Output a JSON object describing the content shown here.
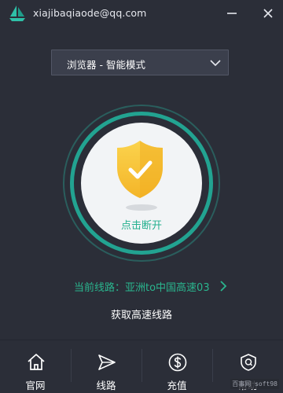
{
  "titlebar": {
    "account": "xiajibaqiaode@qq.com",
    "logo_icon": "sailboat-logo-icon",
    "minimize_icon": "minimize-icon",
    "close_icon": "close-icon"
  },
  "mode_select": {
    "value": "浏览器 - 智能模式",
    "icon": "chevron-down-icon"
  },
  "connect_button": {
    "label": "点击断开",
    "icon": "shield-check-icon",
    "status_color": "#25b08f"
  },
  "route": {
    "label": "当前线路：亚洲to中国高速03",
    "arrow_icon": "chevron-right-icon"
  },
  "fast_route": {
    "label": "获取高速线路"
  },
  "bottom_nav": {
    "items": [
      {
        "label": "官网",
        "icon": "home-icon"
      },
      {
        "label": "线路",
        "icon": "send-icon"
      },
      {
        "label": "充值",
        "icon": "dollar-icon"
      },
      {
        "label": "帮助",
        "icon": "help-icon"
      }
    ]
  },
  "watermark": "百事网 soft98",
  "colors": {
    "background": "#2b2e38",
    "accent": "#25b08f",
    "shield": "#f7c23c"
  }
}
